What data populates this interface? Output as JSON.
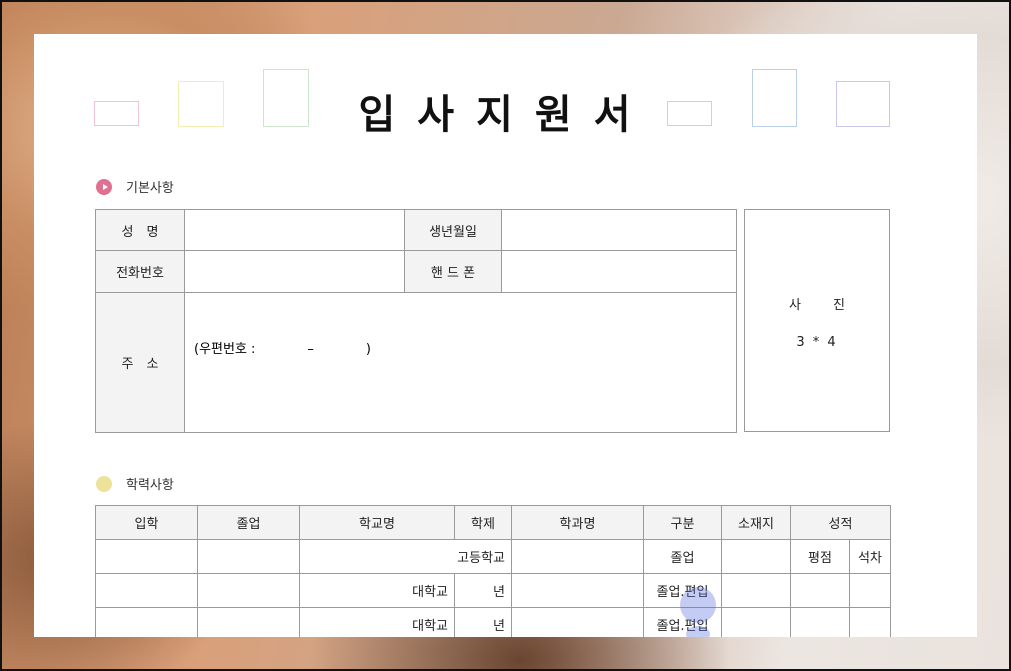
{
  "document": {
    "title": "입사지원서",
    "basic_section": "기본사항",
    "education_section": "학력사항",
    "basic": {
      "name_label": "성　명",
      "birth_label": "생년월일",
      "phone_label": "전화번호",
      "mobile_label": "핸 드 폰",
      "address_label": "주　소",
      "postal_text": "(우편번호 :　　　　–　　　　)",
      "photo_label": "사 진",
      "photo_size": "3 * 4"
    },
    "education": {
      "headers": [
        "입학",
        "졸업",
        "학교명",
        "학제",
        "학과명",
        "구분",
        "소재지",
        "성적"
      ],
      "sub_headers": [
        "평점",
        "석차"
      ],
      "rows": [
        {
          "school": "고등학교",
          "system": "",
          "type": "졸업"
        },
        {
          "school": "대학교",
          "system": "년",
          "type": "졸업.편입"
        },
        {
          "school": "대학교",
          "system": "년",
          "type": "졸업.편입"
        }
      ]
    }
  },
  "colors": {
    "deco": [
      "#f2c4d0",
      "#f3eeb0",
      "#cfe4cc",
      "#bcd6ec",
      "#b8d0ea",
      "#c8c8ec"
    ],
    "basic_bullet": "#e07090",
    "education_bullet": "#ece29a"
  }
}
